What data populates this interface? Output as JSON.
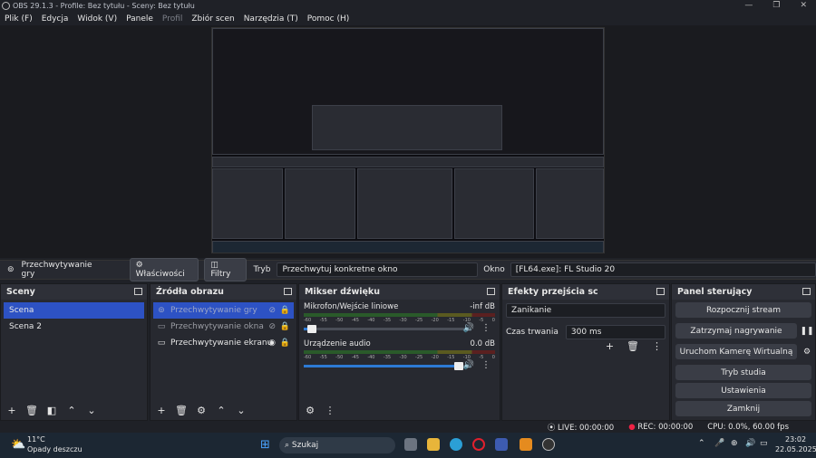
{
  "window": {
    "title": "OBS 29.1.3 - Profile: Bez tytułu - Sceny: Bez tytułu"
  },
  "menu": [
    "Plik (F)",
    "Edycja",
    "Widok (V)",
    "Panele",
    "Profil",
    "Zbiór scen",
    "Narzędzia (T)",
    "Pomoc (H)"
  ],
  "context": {
    "source_name": "Przechwytywanie gry",
    "properties": "Właściwości",
    "filters": "Filtry",
    "mode_label": "Tryb",
    "mode_value": "Przechwytuj konkretne okno",
    "window_label": "Okno",
    "window_value": "[FL64.exe]: FL Studio 20"
  },
  "scenes": {
    "title": "Sceny",
    "items": [
      "Scena",
      "Scena 2"
    ]
  },
  "sources": {
    "title": "Źródła obrazu",
    "items": [
      "Przechwytywanie gry",
      "Przechwytywanie okna",
      "Przechwytywanie ekranu"
    ]
  },
  "mixer": {
    "title": "Mikser dźwięku",
    "channels": [
      {
        "name": "Mikrofon/Wejście liniowe",
        "level": "-inf dB",
        "volume": 0.05
      },
      {
        "name": "Urządzenie audio",
        "level": "0.0 dB",
        "volume": 0.95
      }
    ],
    "ticks": [
      "-60",
      "-55",
      "-50",
      "-45",
      "-40",
      "-35",
      "-30",
      "-25",
      "-20",
      "-15",
      "-10",
      "-5",
      "0"
    ]
  },
  "transitions": {
    "title": "Efekty przejścia sc",
    "type": "Zanikanie",
    "duration_label": "Czas trwania",
    "duration_value": "300 ms"
  },
  "controls": {
    "title": "Panel sterujący",
    "buttons": [
      "Rozpocznij stream",
      "Zatrzymaj nagrywanie",
      "Uruchom Kamerę Wirtualną",
      "Tryb studia",
      "Ustawienia",
      "Zamknij"
    ]
  },
  "status": {
    "live": "LIVE: 00:00:00",
    "rec": "REC: 00:00:00",
    "cpu": "CPU: 0.0%, 60.00 fps"
  },
  "taskbar": {
    "temp": "11°C",
    "weather": "Opady deszczu",
    "search": "Szukaj",
    "time": "23:02",
    "date": "22.05.2025"
  },
  "colors": {
    "accent": "#2d52c4",
    "bg": "#272930"
  }
}
